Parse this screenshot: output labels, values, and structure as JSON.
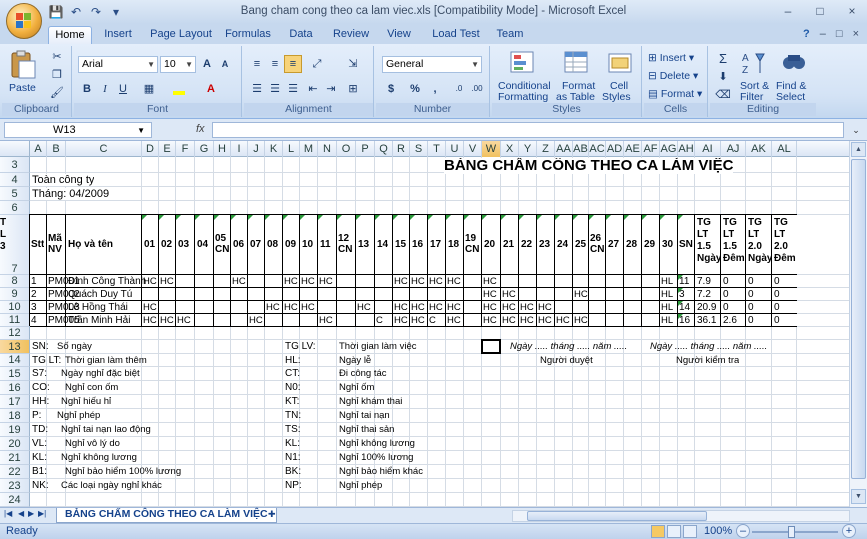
{
  "window": {
    "title": "Bang cham cong theo ca lam viec.xls  [Compatibility Mode] - Microsoft Excel",
    "controls": [
      "–",
      "□",
      "×"
    ]
  },
  "qat": [
    "💾",
    "↶",
    "↷",
    "▾"
  ],
  "tabs": [
    "Home",
    "Insert",
    "Page Layout",
    "Formulas",
    "Data",
    "Review",
    "View",
    "Load Test",
    "Team"
  ],
  "tab_right": [
    "?",
    "–",
    "□",
    "×"
  ],
  "ribbon": {
    "clipboard": {
      "paste": "Paste",
      "label": "Clipboard"
    },
    "font": {
      "name": "Arial",
      "size": "10",
      "grow": "A",
      "shrink": "A",
      "bold": "B",
      "italic": "I",
      "underline": "U",
      "label": "Font"
    },
    "alignment": {
      "label": "Alignment"
    },
    "number": {
      "format": "General",
      "currency": "$",
      "percent": "%",
      "comma": ",",
      "label": "Number"
    },
    "styles": {
      "cond": "Conditional",
      "cond2": "Formatting",
      "fmt_table": "Format",
      "fmt_table2": "as Table",
      "cell_styles": "Cell",
      "cell_styles2": "Styles",
      "label": "Styles"
    },
    "cells": {
      "insert": "Insert",
      "delete": "Delete",
      "format": "Format",
      "label": "Cells"
    },
    "editing": {
      "sum": "Σ",
      "sort": "Sort &",
      "sort2": "Filter",
      "find": "Find &",
      "find2": "Select",
      "label": "Editing"
    }
  },
  "formula_bar": {
    "name_box": "W13",
    "fx": "fx",
    "value": ""
  },
  "columns": [
    "A",
    "B",
    "C",
    "D",
    "E",
    "F",
    "G",
    "H",
    "I",
    "J",
    "K",
    "L",
    "M",
    "N",
    "O",
    "P",
    "Q",
    "R",
    "S",
    "T",
    "U",
    "V",
    "W",
    "X",
    "Y",
    "Z",
    "AA",
    "AB",
    "AC",
    "AD",
    "AE",
    "AF",
    "AG",
    "AH",
    "AI",
    "AJ",
    "AK",
    "AL"
  ],
  "selected_column": "W",
  "rows": [
    "3",
    "4",
    "5",
    "6",
    "7",
    "8",
    "9",
    "10",
    "11",
    "12",
    "13",
    "14",
    "15",
    "16",
    "17",
    "18",
    "19",
    "20",
    "21",
    "22",
    "23",
    "24"
  ],
  "selected_row": "13",
  "sheet": {
    "title": "BẢNG CHẤM CÔNG THEO CA LÀM VIỆC",
    "company": "Toàn công ty",
    "month": "Tháng: 04/2009",
    "headers": {
      "stt": "Stt",
      "ma": "Mã",
      "ma2": "NV",
      "name": "Họ và tên",
      "days": [
        "01",
        "02",
        "03",
        "04",
        "05",
        "06",
        "07",
        "08",
        "09",
        "10",
        "11",
        "12",
        "13",
        "14",
        "15",
        "16",
        "17",
        "18",
        "19",
        "20",
        "21",
        "22",
        "23",
        "24",
        "25",
        "26",
        "27",
        "28",
        "29",
        "30"
      ],
      "cn": "CN",
      "sn": "SN",
      "tg": [
        [
          "TG",
          "LT",
          "1.5",
          "Ngày"
        ],
        [
          "TG",
          "LT",
          "1.5",
          "Đêm"
        ],
        [
          "TG",
          "LT",
          "2.0",
          "Ngày"
        ],
        [
          "TG",
          "LT",
          "2.0",
          "Đêm"
        ],
        [
          "T",
          "L",
          "3",
          ""
        ]
      ]
    },
    "employees": [
      {
        "stt": "1",
        "code": "PM001",
        "name": "Đinh Công Thành",
        "marks": {
          "D": "HC",
          "E": "HC",
          "I": "HC",
          "L": "HC",
          "M": "HC",
          "N": "HC",
          "R": "HC",
          "S": "HC",
          "T": "HC",
          "U": "HC",
          "W": "HC"
        },
        "ag": "HL",
        "sn": "11",
        "tg": [
          "7.9",
          "0",
          "0",
          "0"
        ]
      },
      {
        "stt": "2",
        "code": "PM002",
        "name": "Quách Duy Tú",
        "marks": {
          "W": "HC",
          "X": "HC",
          "AB": "HC"
        },
        "ag": "HL",
        "sn": "3",
        "tg": [
          "7.2",
          "0",
          "0",
          "0"
        ]
      },
      {
        "stt": "3",
        "code": "PM003",
        "name": "Lê Hồng Thái",
        "marks": {
          "D": "HC",
          "K": "HC",
          "L": "HC",
          "M": "HC",
          "P": "HC",
          "R": "HC",
          "S": "HC",
          "T": "HC",
          "U": "HC",
          "W": "HC",
          "X": "HC",
          "Y": "HC",
          "Z": "HC"
        },
        "ag": "HL",
        "sn": "14",
        "tg": [
          "20.9",
          "0",
          "0",
          "0"
        ]
      },
      {
        "stt": "4",
        "code": "PM005",
        "name": "Trần Minh Hải",
        "marks": {
          "D": "HC",
          "E": "HC",
          "F": "HC",
          "J": "HC",
          "N": "HC",
          "Q": "C",
          "R": "HC",
          "S": "HC",
          "T": "C",
          "U": "HC",
          "W": "HC",
          "X": "HC",
          "Y": "HC",
          "Z": "HC",
          "AA": "HC",
          "AB": "HC"
        },
        "ag": "HL",
        "sn": "16",
        "tg": [
          "36.1",
          "2.6",
          "0",
          "0"
        ]
      }
    ],
    "legend_left": [
      [
        "SN:",
        "Số ngày"
      ],
      [
        "TG LT:",
        "Thời gian làm thêm"
      ],
      [
        "S7:",
        "Ngày nghỉ đặc biệt"
      ],
      [
        "CO:",
        "Nghỉ con ốm"
      ],
      [
        "HH:",
        "Nghỉ hiếu hỉ"
      ],
      [
        "P:",
        "Nghỉ phép"
      ],
      [
        "TD:",
        "Nghỉ tai nạn lao động"
      ],
      [
        "VL:",
        "Nghỉ vô lý do"
      ],
      [
        "KL:",
        "Nghỉ không lương"
      ],
      [
        "B1:",
        "Nghỉ bảo hiểm 100% lương"
      ],
      [
        "NK:",
        "Các loại ngày nghỉ khác"
      ]
    ],
    "legend_right": [
      [
        "TG LV:",
        "Thời gian làm việc"
      ],
      [
        "HL:",
        "Ngày lễ"
      ],
      [
        "CT:",
        "Đi công tác"
      ],
      [
        "N0:",
        "Nghỉ ốm"
      ],
      [
        "KT:",
        "Nghỉ khám thai"
      ],
      [
        "TN:",
        "Nghỉ tai nạn"
      ],
      [
        "TS:",
        "Nghỉ thai sản"
      ],
      [
        "KL:",
        "Nghỉ không lương"
      ],
      [
        "N1:",
        "Nghỉ 100% lương"
      ],
      [
        "BK:",
        "Nghỉ bảo hiểm khác"
      ],
      [
        "NP:",
        "Nghỉ phép"
      ]
    ],
    "sign1_date": "Ngày ..... tháng ..... năm .....",
    "sign1_role": "Người duyệt",
    "sign2_date": "Ngày ..... tháng ..... năm .....",
    "sign2_role": "Người kiểm tra"
  },
  "sheet_tab": "BẢNG CHẤM CÔNG THEO CA LÀM VIỆC",
  "status": {
    "text": "Ready",
    "zoom": "100%",
    "minus": "–",
    "plus": "+"
  }
}
